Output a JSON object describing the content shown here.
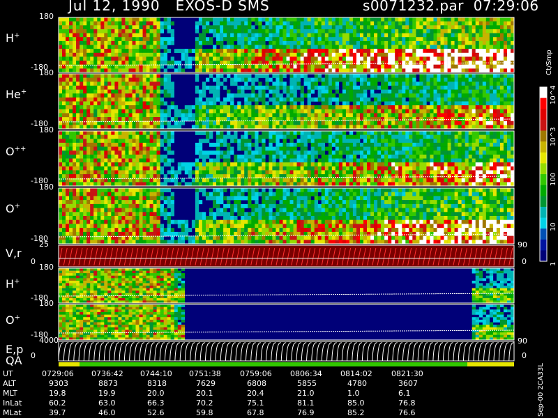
{
  "header": {
    "date_title": "Jul 12, 1990   EXOS-D SMS",
    "file_time": "s0071232.par  07:29:06"
  },
  "panels": [
    {
      "id": "h-plus-1",
      "label": "H",
      "sup": "+",
      "top_tick": "180",
      "bottom_tick": "-180",
      "kind": "spectrogram",
      "fill": 0.9
    },
    {
      "id": "he-plus",
      "label": "He",
      "sup": "+",
      "top_tick": "180",
      "bottom_tick": "-180",
      "kind": "spectrogram",
      "fill": 0.5
    },
    {
      "id": "o-plus-plus",
      "label": "O",
      "sup": "++",
      "top_tick": "180",
      "bottom_tick": "-180",
      "kind": "spectrogram",
      "fill": 0.6
    },
    {
      "id": "o-plus-1",
      "label": "O",
      "sup": "+",
      "top_tick": "180",
      "bottom_tick": "-180",
      "kind": "spectrogram",
      "fill": 0.7
    },
    {
      "id": "vr",
      "label": "V,r",
      "sup": "",
      "top_tick": "25",
      "bottom_tick": "0",
      "right_tick": "90",
      "right_bottom": "0",
      "kind": "velocity"
    },
    {
      "id": "h-plus-2",
      "label": "H",
      "sup": "+",
      "top_tick": "180",
      "bottom_tick": "-180",
      "kind": "spectrogram2"
    },
    {
      "id": "o-plus-2",
      "label": "O",
      "sup": "+",
      "top_tick": "180",
      "bottom_tick": "-180",
      "kind": "spectrogram2"
    },
    {
      "id": "ep",
      "label": "E,p",
      "sup": "",
      "top_tick": "4000",
      "bottom_tick": "0",
      "right_tick": "90",
      "right_bottom": "0",
      "kind": "energy"
    }
  ],
  "qa_label": "QA",
  "colorbar": {
    "unit": "Ct/Smp",
    "ticks": [
      "10^4",
      "10^3",
      "100",
      "10",
      "1"
    ],
    "colors": [
      "#ffffff",
      "#ff0000",
      "#e00000",
      "#c81414",
      "#a07800",
      "#c8b400",
      "#e6e600",
      "#96dc00",
      "#32c800",
      "#00aa00",
      "#009632",
      "#00b4b4",
      "#00d2e6",
      "#0050b4",
      "#0014a0",
      "#000078"
    ]
  },
  "orbit_table": {
    "rows": [
      {
        "label": "UT",
        "values": [
          "0729:06",
          "0736:42",
          "0744:10",
          "0751:38",
          "0759:06",
          "0806:34",
          "0814:02",
          "0821:30"
        ]
      },
      {
        "label": "ALT",
        "values": [
          "9303",
          "8873",
          "8318",
          "7629",
          "6808",
          "5855",
          "4780",
          "3607"
        ]
      },
      {
        "label": "MLT",
        "values": [
          "19.8",
          "19.9",
          "20.0",
          "20.1",
          "20.4",
          "21.0",
          "1.0",
          "6.1"
        ]
      },
      {
        "label": "InLat",
        "values": [
          "60.2",
          "63.0",
          "66.3",
          "70.2",
          "75.1",
          "81.1",
          "85.0",
          "76.8"
        ]
      },
      {
        "label": "MLat",
        "values": [
          "39.7",
          "46.0",
          "52.6",
          "59.8",
          "67.8",
          "76.9",
          "85.2",
          "76.6"
        ]
      }
    ]
  },
  "footer_code": "Sep-00  2CA33L"
}
